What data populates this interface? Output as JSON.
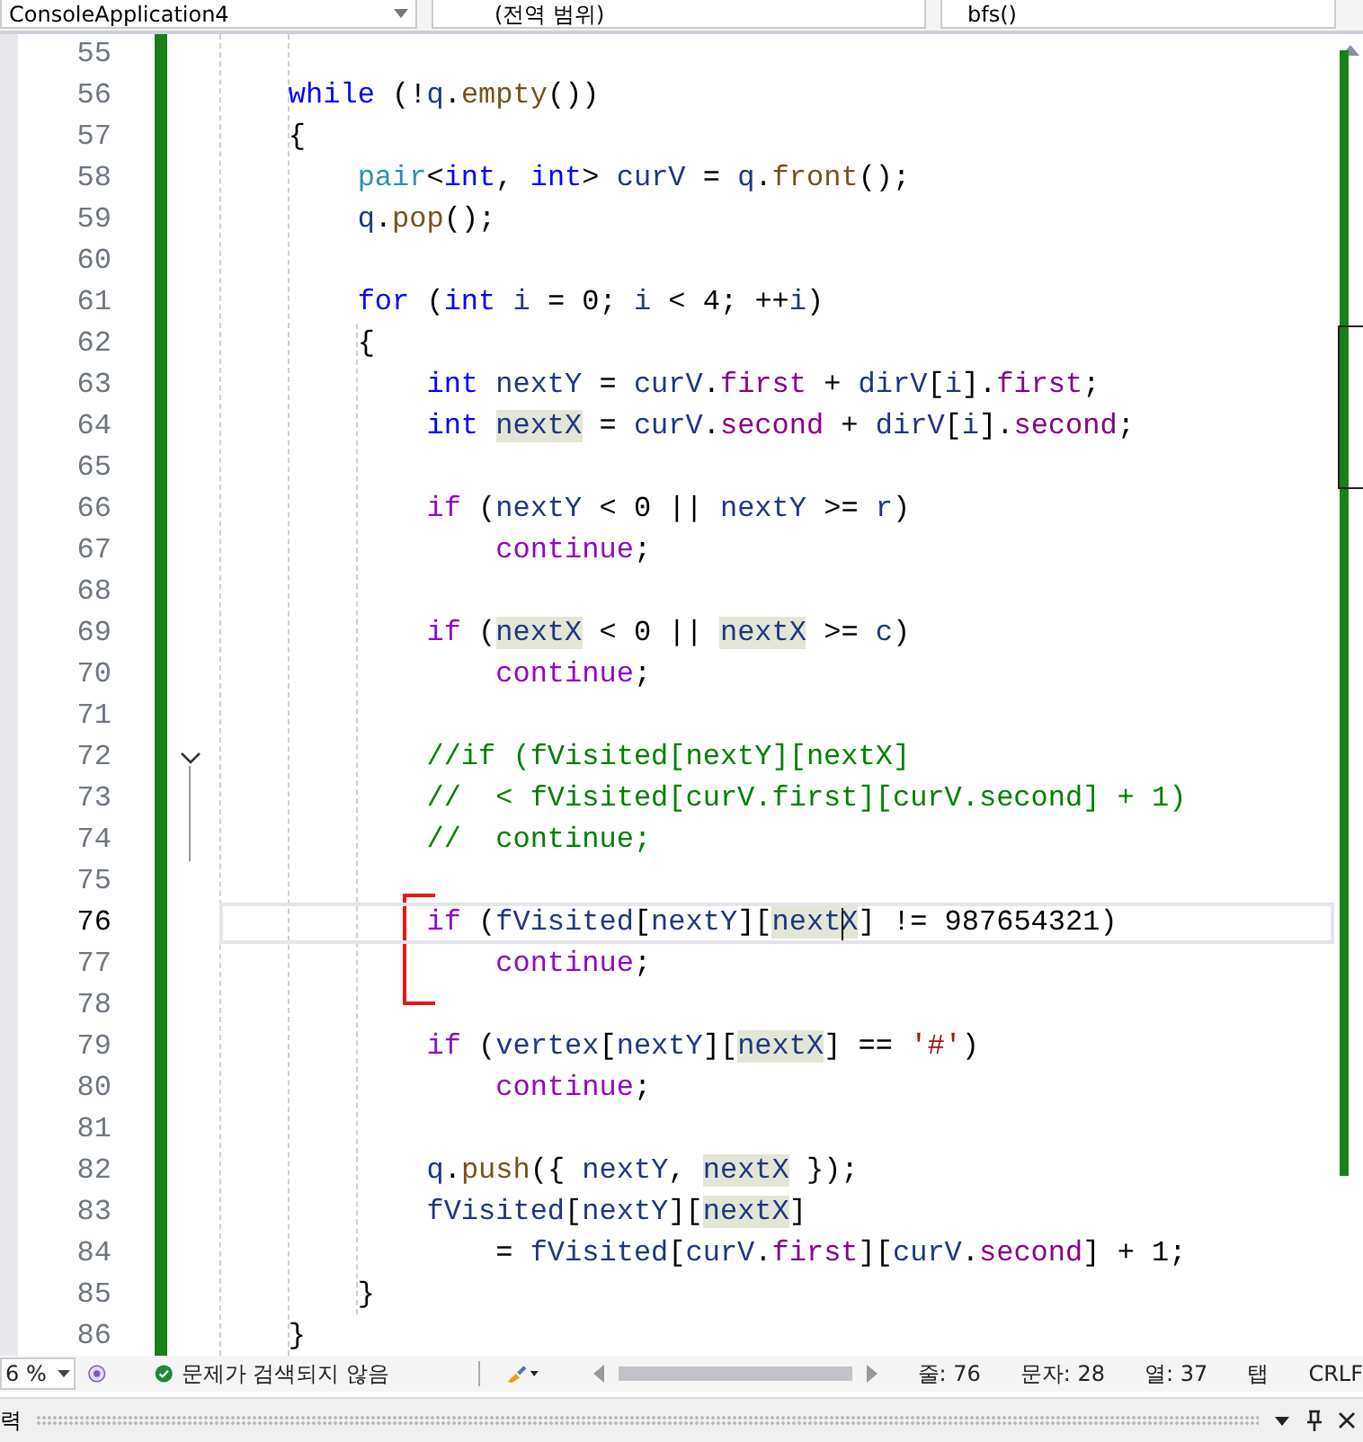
{
  "navigation_bar": {
    "project": "ConsoleApplication4",
    "scope": "(전역 범위)",
    "member": "bfs()"
  },
  "editor": {
    "lines": [
      {
        "number": "55",
        "selected": false,
        "fold": false
      },
      {
        "number": "56",
        "selected": false,
        "fold": false,
        "tokens": [
          {
            "kind": "kw",
            "text": "    while"
          },
          {
            "kind": "p",
            "text": " (!"
          },
          {
            "kind": "v",
            "text": "q"
          },
          {
            "kind": "p",
            "text": "."
          },
          {
            "kind": "fn",
            "text": "empty"
          },
          {
            "kind": "p",
            "text": "())"
          }
        ]
      },
      {
        "number": "57",
        "selected": false,
        "fold": false,
        "tokens": [
          {
            "kind": "p",
            "text": "    {"
          }
        ]
      },
      {
        "number": "58",
        "selected": false,
        "fold": false,
        "tokens": [
          {
            "kind": "ty",
            "text": "        pair"
          },
          {
            "kind": "p",
            "text": "<"
          },
          {
            "kind": "kw",
            "text": "int"
          },
          {
            "kind": "p",
            "text": ", "
          },
          {
            "kind": "kw",
            "text": "int"
          },
          {
            "kind": "p",
            "text": "> "
          },
          {
            "kind": "v",
            "text": "curV"
          },
          {
            "kind": "p",
            "text": " = "
          },
          {
            "kind": "v",
            "text": "q"
          },
          {
            "kind": "p",
            "text": "."
          },
          {
            "kind": "fn",
            "text": "front"
          },
          {
            "kind": "p",
            "text": "();"
          }
        ]
      },
      {
        "number": "59",
        "selected": false,
        "fold": false,
        "tokens": [
          {
            "kind": "v",
            "text": "        q"
          },
          {
            "kind": "p",
            "text": "."
          },
          {
            "kind": "fn",
            "text": "pop"
          },
          {
            "kind": "p",
            "text": "();"
          }
        ]
      },
      {
        "number": "60",
        "selected": false,
        "fold": false
      },
      {
        "number": "61",
        "selected": false,
        "fold": false,
        "tokens": [
          {
            "kind": "kw",
            "text": "        for"
          },
          {
            "kind": "p",
            "text": " ("
          },
          {
            "kind": "kw",
            "text": "int "
          },
          {
            "kind": "v",
            "text": "i"
          },
          {
            "kind": "p",
            "text": " = "
          },
          {
            "kind": "num",
            "text": "0"
          },
          {
            "kind": "p",
            "text": "; "
          },
          {
            "kind": "v",
            "text": "i"
          },
          {
            "kind": "p",
            "text": " < "
          },
          {
            "kind": "num",
            "text": "4"
          },
          {
            "kind": "p",
            "text": "; ++"
          },
          {
            "kind": "v",
            "text": "i"
          },
          {
            "kind": "p",
            "text": ")"
          }
        ]
      },
      {
        "number": "62",
        "selected": false,
        "fold": false,
        "tokens": [
          {
            "kind": "p",
            "text": "        {"
          }
        ]
      },
      {
        "number": "63",
        "selected": false,
        "fold": false,
        "tokens": [
          {
            "kind": "kw",
            "text": "            int "
          },
          {
            "kind": "v",
            "text": "nextY"
          },
          {
            "kind": "p",
            "text": " = "
          },
          {
            "kind": "v",
            "text": "curV"
          },
          {
            "kind": "p",
            "text": "."
          },
          {
            "kind": "m",
            "text": "first"
          },
          {
            "kind": "p",
            "text": " + "
          },
          {
            "kind": "v",
            "text": "dirV"
          },
          {
            "kind": "p",
            "text": "["
          },
          {
            "kind": "v",
            "text": "i"
          },
          {
            "kind": "p",
            "text": "]."
          },
          {
            "kind": "m",
            "text": "first"
          },
          {
            "kind": "p",
            "text": ";"
          }
        ]
      },
      {
        "number": "64",
        "selected": false,
        "fold": false,
        "tokens": [
          {
            "kind": "kw",
            "text": "            int "
          },
          {
            "kind": "ref",
            "text": "nextX"
          },
          {
            "kind": "p",
            "text": " = "
          },
          {
            "kind": "v",
            "text": "curV"
          },
          {
            "kind": "p",
            "text": "."
          },
          {
            "kind": "m",
            "text": "second"
          },
          {
            "kind": "p",
            "text": " + "
          },
          {
            "kind": "v",
            "text": "dirV"
          },
          {
            "kind": "p",
            "text": "["
          },
          {
            "kind": "v",
            "text": "i"
          },
          {
            "kind": "p",
            "text": "]."
          },
          {
            "kind": "m",
            "text": "second"
          },
          {
            "kind": "p",
            "text": ";"
          }
        ]
      },
      {
        "number": "65",
        "selected": false,
        "fold": false
      },
      {
        "number": "66",
        "selected": false,
        "fold": false,
        "tokens": [
          {
            "kind": "ctl",
            "text": "            if"
          },
          {
            "kind": "p",
            "text": " ("
          },
          {
            "kind": "v",
            "text": "nextY"
          },
          {
            "kind": "p",
            "text": " < "
          },
          {
            "kind": "num",
            "text": "0"
          },
          {
            "kind": "p",
            "text": " || "
          },
          {
            "kind": "v",
            "text": "nextY"
          },
          {
            "kind": "p",
            "text": " >= "
          },
          {
            "kind": "v",
            "text": "r"
          },
          {
            "kind": "p",
            "text": ")"
          }
        ]
      },
      {
        "number": "67",
        "selected": false,
        "fold": false,
        "tokens": [
          {
            "kind": "ctl",
            "text": "                continue"
          },
          {
            "kind": "p",
            "text": ";"
          }
        ]
      },
      {
        "number": "68",
        "selected": false,
        "fold": false
      },
      {
        "number": "69",
        "selected": false,
        "fold": false,
        "tokens": [
          {
            "kind": "ctl",
            "text": "            if"
          },
          {
            "kind": "p",
            "text": " ("
          },
          {
            "kind": "ref",
            "text": "nextX"
          },
          {
            "kind": "p",
            "text": " < "
          },
          {
            "kind": "num",
            "text": "0"
          },
          {
            "kind": "p",
            "text": " || "
          },
          {
            "kind": "ref",
            "text": "nextX"
          },
          {
            "kind": "p",
            "text": " >= "
          },
          {
            "kind": "v",
            "text": "c"
          },
          {
            "kind": "p",
            "text": ")"
          }
        ]
      },
      {
        "number": "70",
        "selected": false,
        "fold": false,
        "tokens": [
          {
            "kind": "ctl",
            "text": "                continue"
          },
          {
            "kind": "p",
            "text": ";"
          }
        ]
      },
      {
        "number": "71",
        "selected": false,
        "fold": false
      },
      {
        "number": "72",
        "selected": false,
        "fold": true,
        "tokens": [
          {
            "kind": "cmt",
            "text": "            //if (fVisited[nextY][nextX]"
          }
        ]
      },
      {
        "number": "73",
        "selected": false,
        "fold": false,
        "tokens": [
          {
            "kind": "cmt",
            "text": "            //  < fVisited[curV.first][curV.second] + 1)"
          }
        ]
      },
      {
        "number": "74",
        "selected": false,
        "fold": false,
        "tokens": [
          {
            "kind": "cmt",
            "text": "            //  continue;"
          }
        ]
      },
      {
        "number": "75",
        "selected": false,
        "fold": false
      },
      {
        "number": "76",
        "selected": true,
        "fold": false,
        "tokens": [
          {
            "kind": "ctl",
            "text": "            if"
          },
          {
            "kind": "p",
            "text": " ("
          },
          {
            "kind": "v",
            "text": "fVisited"
          },
          {
            "kind": "p",
            "text": "["
          },
          {
            "kind": "v",
            "text": "nextY"
          },
          {
            "kind": "p",
            "text": "]["
          },
          {
            "kind": "ref",
            "text": "nextX"
          },
          {
            "kind": "p",
            "text": "] != "
          },
          {
            "kind": "num",
            "text": "987654321"
          },
          {
            "kind": "p",
            "text": ")"
          }
        ]
      },
      {
        "number": "77",
        "selected": false,
        "fold": false,
        "tokens": [
          {
            "kind": "ctl",
            "text": "                continue"
          },
          {
            "kind": "p",
            "text": ";"
          }
        ]
      },
      {
        "number": "78",
        "selected": false,
        "fold": false
      },
      {
        "number": "79",
        "selected": false,
        "fold": false,
        "tokens": [
          {
            "kind": "ctl",
            "text": "            if"
          },
          {
            "kind": "p",
            "text": " ("
          },
          {
            "kind": "v",
            "text": "vertex"
          },
          {
            "kind": "p",
            "text": "["
          },
          {
            "kind": "v",
            "text": "nextY"
          },
          {
            "kind": "p",
            "text": "]["
          },
          {
            "kind": "ref",
            "text": "nextX"
          },
          {
            "kind": "p",
            "text": "] == "
          },
          {
            "kind": "str",
            "text": "'#'"
          },
          {
            "kind": "p",
            "text": ")"
          }
        ]
      },
      {
        "number": "80",
        "selected": false,
        "fold": false,
        "tokens": [
          {
            "kind": "ctl",
            "text": "                continue"
          },
          {
            "kind": "p",
            "text": ";"
          }
        ]
      },
      {
        "number": "81",
        "selected": false,
        "fold": false
      },
      {
        "number": "82",
        "selected": false,
        "fold": false,
        "tokens": [
          {
            "kind": "v",
            "text": "            q"
          },
          {
            "kind": "p",
            "text": "."
          },
          {
            "kind": "fn",
            "text": "push"
          },
          {
            "kind": "p",
            "text": "({ "
          },
          {
            "kind": "v",
            "text": "nextY"
          },
          {
            "kind": "p",
            "text": ", "
          },
          {
            "kind": "ref",
            "text": "nextX"
          },
          {
            "kind": "p",
            "text": " });"
          }
        ]
      },
      {
        "number": "83",
        "selected": false,
        "fold": false,
        "tokens": [
          {
            "kind": "v",
            "text": "            fVisited"
          },
          {
            "kind": "p",
            "text": "["
          },
          {
            "kind": "v",
            "text": "nextY"
          },
          {
            "kind": "p",
            "text": "]["
          },
          {
            "kind": "ref",
            "text": "nextX"
          },
          {
            "kind": "p",
            "text": "]"
          }
        ]
      },
      {
        "number": "84",
        "selected": false,
        "fold": false,
        "tokens": [
          {
            "kind": "p",
            "text": "                = "
          },
          {
            "kind": "v",
            "text": "fVisited"
          },
          {
            "kind": "p",
            "text": "["
          },
          {
            "kind": "v",
            "text": "curV"
          },
          {
            "kind": "p",
            "text": "."
          },
          {
            "kind": "m",
            "text": "first"
          },
          {
            "kind": "p",
            "text": "]["
          },
          {
            "kind": "v",
            "text": "curV"
          },
          {
            "kind": "p",
            "text": "."
          },
          {
            "kind": "m",
            "text": "second"
          },
          {
            "kind": "p",
            "text": "] + "
          },
          {
            "kind": "num",
            "text": "1"
          },
          {
            "kind": "p",
            "text": ";"
          }
        ]
      },
      {
        "number": "85",
        "selected": false,
        "fold": false,
        "tokens": [
          {
            "kind": "p",
            "text": "        }"
          }
        ]
      },
      {
        "number": "86",
        "selected": false,
        "fold": false,
        "tokens": [
          {
            "kind": "p",
            "text": "    }"
          }
        ]
      }
    ]
  },
  "status_bar": {
    "zoom": "6 %",
    "issues": "문제가 검색되지 않음",
    "line": "줄: 76",
    "char": "문자: 28",
    "column": "열: 37",
    "indent": "탭",
    "line_ending": "CRLF"
  },
  "output_panel": {
    "title": "력"
  }
}
